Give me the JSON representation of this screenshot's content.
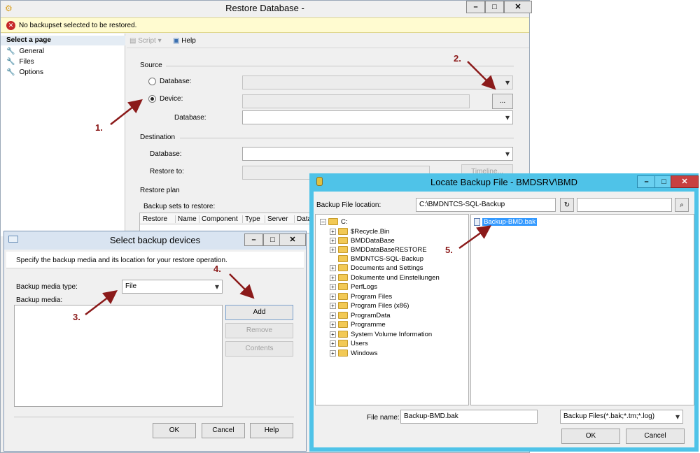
{
  "restore": {
    "title": "Restore Database -",
    "error": "No backupset selected to be restored.",
    "select_page": "Select a page",
    "pages": [
      "General",
      "Files",
      "Options"
    ],
    "toolbar": {
      "script": "Script",
      "help": "Help"
    },
    "source": {
      "header": "Source",
      "database_label": "Database:",
      "device_label": "Device:",
      "device_db_label": "Database:",
      "browse": "..."
    },
    "destination": {
      "header": "Destination",
      "database_label": "Database:",
      "restore_to_label": "Restore to:",
      "timeline": "Timeline..."
    },
    "plan": {
      "header": "Restore plan",
      "sets_label": "Backup sets to restore:",
      "columns": [
        "Restore",
        "Name",
        "Component",
        "Type",
        "Server",
        "Data"
      ]
    }
  },
  "select_devices": {
    "title": "Select backup devices",
    "description": "Specify the backup media and its location for your restore operation.",
    "media_type_label": "Backup media type:",
    "media_type_value": "File",
    "media_label": "Backup media:",
    "add": "Add",
    "remove": "Remove",
    "contents": "Contents",
    "ok": "OK",
    "cancel": "Cancel",
    "help": "Help"
  },
  "locate": {
    "title": "Locate Backup File - BMDSRV\\BMD",
    "location_label": "Backup File location:",
    "location_value": "C:\\BMDNTCS-SQL-Backup",
    "tree_root": "C:",
    "tree": [
      "$Recycle.Bin",
      "BMDDataBase",
      "BMDDataBaseRESTORE",
      "BMDNTCS-SQL-Backup",
      "Documents and Settings",
      "Dokumente und Einstellungen",
      "PerfLogs",
      "Program Files",
      "Program Files (x86)",
      "ProgramData",
      "Programme",
      "System Volume Information",
      "Users",
      "Windows"
    ],
    "file": "Backup-BMD.bak",
    "file_name_label": "File name:",
    "file_name_value": "Backup-BMD.bak",
    "filter_value": "Backup Files(*.bak;*.tm;*.log)",
    "ok": "OK",
    "cancel": "Cancel"
  },
  "annotations": [
    "1.",
    "2.",
    "3.",
    "4.",
    "5."
  ],
  "colors": {
    "accent_cyan": "#4fc3e8",
    "error_bar": "#fffbd0",
    "arrow": "#8b1a1a",
    "selection": "#3399ff"
  }
}
